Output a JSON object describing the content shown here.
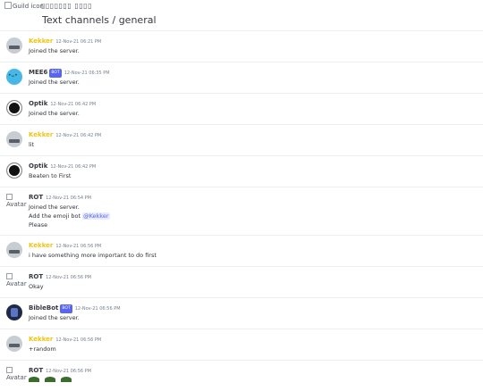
{
  "header": {
    "guild_icon_alt": "Guild icon",
    "guild_name": "▯▯▯▯▯▯▯ ▯▯▯▯",
    "channel_path": "Text channels / general"
  },
  "messages": [
    {
      "author": "Kekker",
      "bot": false,
      "ts": "12-Nov-21 06:21 PM",
      "lines": [
        "Joined the server."
      ]
    },
    {
      "author": "MEE6",
      "bot": true,
      "bot_label": "BOT",
      "ts": "12-Nov-21 06:35 PM",
      "lines": [
        "Joined the server."
      ]
    },
    {
      "author": "Optik",
      "bot": false,
      "ts": "12-Nov-21 06:42 PM",
      "lines": [
        "Joined the server."
      ]
    },
    {
      "author": "Kekker",
      "bot": false,
      "ts": "12-Nov-21 06:42 PM",
      "lines": [
        "lit"
      ]
    },
    {
      "author": "Optik",
      "bot": false,
      "ts": "12-Nov-21 06:42 PM",
      "lines": [
        "Beaten to First"
      ]
    },
    {
      "author": "ROT",
      "bot": false,
      "avatar_alt": "Avatar",
      "ts": "12-Nov-21 06:54 PM",
      "lines": [
        "Joined the server.",
        "Add the emoji bot ",
        "Please"
      ],
      "mention": "@Kekker"
    },
    {
      "author": "Kekker",
      "bot": false,
      "ts": "12-Nov-21 06:56 PM",
      "lines": [
        "i have something more important to do first"
      ]
    },
    {
      "author": "ROT",
      "bot": false,
      "avatar_alt": "Avatar",
      "ts": "12-Nov-21 06:56 PM",
      "lines": [
        "Okay"
      ]
    },
    {
      "author": "BibleBot",
      "bot": true,
      "bot_label": "BOT",
      "ts": "12-Nov-21 06:56 PM",
      "lines": [
        "Joined the server."
      ]
    },
    {
      "author": "Kekker",
      "bot": false,
      "ts": "12-Nov-21 06:56 PM",
      "lines": [
        "+random"
      ]
    },
    {
      "author": "ROT",
      "bot": false,
      "avatar_alt": "Avatar",
      "ts": "12-Nov-21 06:56 PM",
      "lines": []
    }
  ],
  "colors": {
    "kekker": "#f1c40f",
    "bot_tag": "#5865f2",
    "mention_bg": "#e8ebfb"
  }
}
